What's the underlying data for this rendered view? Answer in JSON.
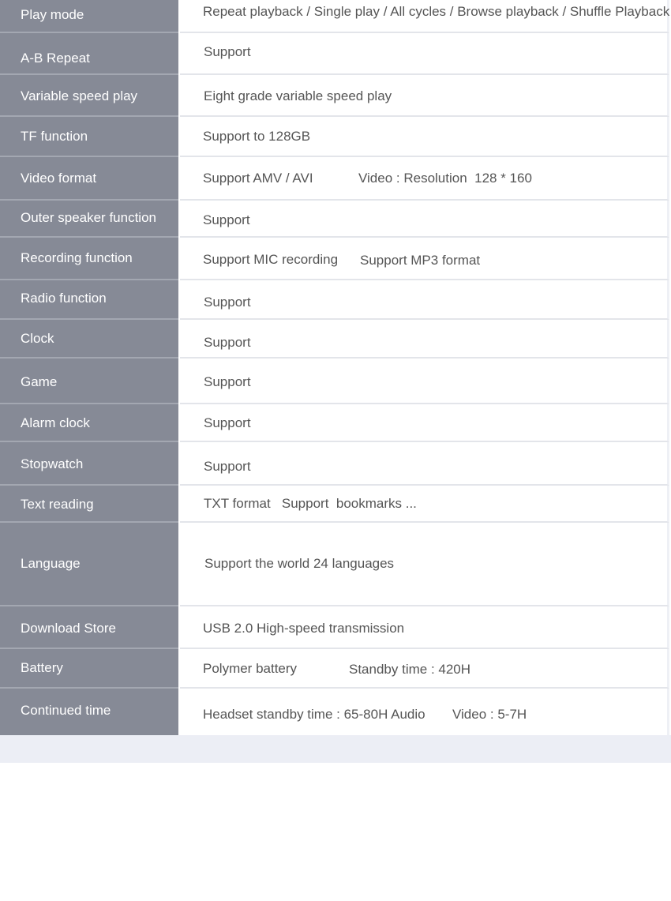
{
  "specs": [
    {
      "label": "Play mode",
      "values": [
        "Repeat playback / Single play / All cycles / Browse playback / Shuffle Playback"
      ]
    },
    {
      "label": "A-B Repeat",
      "values": [
        "Support"
      ]
    },
    {
      "label": "Variable speed play",
      "values": [
        "Eight grade variable speed play"
      ]
    },
    {
      "label": "TF function",
      "values": [
        "Support to 128GB"
      ]
    },
    {
      "label": "Video format",
      "values": [
        "Support AMV / AVI",
        "Video : Resolution  128 * 160"
      ]
    },
    {
      "label": "Outer speaker function",
      "values": [
        "Support"
      ]
    },
    {
      "label": "Recording function",
      "values": [
        "Support MIC recording",
        "Support MP3 format"
      ]
    },
    {
      "label": "Radio function",
      "values": [
        "Support"
      ]
    },
    {
      "label": "Clock",
      "values": [
        "Support"
      ]
    },
    {
      "label": "Game",
      "values": [
        "Support"
      ]
    },
    {
      "label": "Alarm clock",
      "values": [
        "Support"
      ]
    },
    {
      "label": "Stopwatch",
      "values": [
        "Support"
      ]
    },
    {
      "label": "Text reading",
      "values": [
        "TXT format   Support  bookmarks ..."
      ]
    },
    {
      "label": "Language",
      "values": [
        "Support the world 24 languages"
      ]
    },
    {
      "label": "Download Store",
      "values": [
        "USB 2.0 High-speed transmission"
      ]
    },
    {
      "label": "Battery",
      "values": [
        "Polymer battery",
        "Standby time : 420H"
      ]
    },
    {
      "label": "Continued time",
      "values": [
        "Headset standby time : 65-80H Audio",
        "Video : 5-7H"
      ]
    }
  ]
}
